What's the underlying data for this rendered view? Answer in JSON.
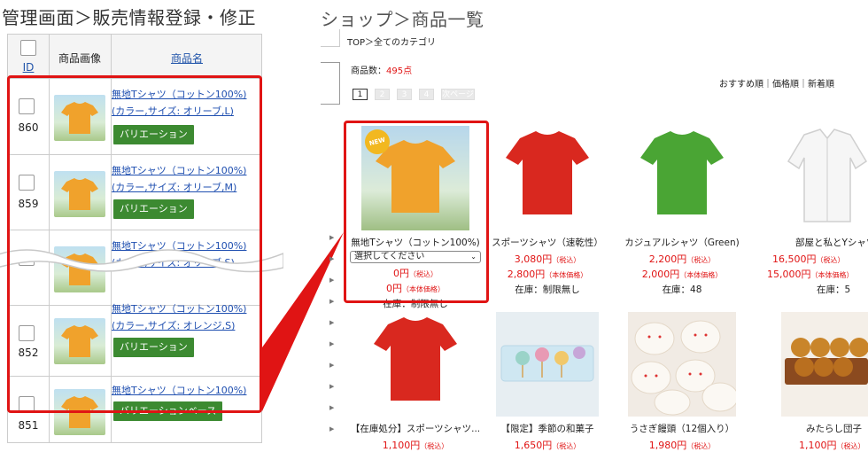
{
  "left": {
    "title": "管理画面＞販売情報登録・修正",
    "headers": {
      "id": "ID",
      "image": "商品画像",
      "name": "商品名"
    },
    "rows": [
      {
        "id": "860",
        "name1": "無地Tシャツ（コットン100%)",
        "name2": "(カラー,サイズ: オリーブ,L)",
        "button": "バリエーション"
      },
      {
        "id": "859",
        "name1": "無地Tシャツ（コットン100%)",
        "name2": "(カラー,サイズ: オリーブ,M)",
        "button": "バリエーション"
      },
      {
        "id": "",
        "name1": "無地Tシャツ（コットン100%)",
        "name2": "(カラー,サイズ: オリーブ,S)",
        "button": ""
      },
      {
        "id": "852",
        "name1": "無地Tシャツ（コットン100%)",
        "name2": "(カラー,サイズ: オレンジ,S)",
        "button": "バリエーション"
      },
      {
        "id": "851",
        "name1": "無地Tシャツ（コットン100%)",
        "name2": "",
        "button": "バリエーションベース"
      }
    ]
  },
  "right": {
    "title": "ショップ＞商品一覧",
    "breadcrumb": "TOP＞全てのカテゴリ",
    "count_label": "商品数：",
    "count_value": "495点",
    "pages": [
      "1",
      "2",
      "3",
      "4",
      "次ページ"
    ],
    "sorts": "おすすめ順｜価格順｜新着順",
    "badge_new": "NEW",
    "products": [
      {
        "title": "無地Tシャツ（コットン100%)",
        "select": "選択してください",
        "price1": "0円",
        "price1_note": "（税込）",
        "price2": "0円",
        "price2_note": "（本体価格）",
        "stock": "在庫：制限無し",
        "color": "#f0a22c"
      },
      {
        "title": "スポーツシャツ（速乾性）",
        "price1": "3,080円",
        "price1_note": "（税込）",
        "price2": "2,800円",
        "price2_note": "（本体価格）",
        "stock": "在庫：制限無し",
        "color": "#d9281f"
      },
      {
        "title": "カジュアルシャツ（Green)",
        "price1": "2,200円",
        "price1_note": "（税込）",
        "price2": "2,000円",
        "price2_note": "（本体価格）",
        "stock": "在庫：48",
        "color": "#4aa534"
      },
      {
        "title": "部屋と私とYシャツ",
        "price1": "16,500円",
        "price1_note": "（税込）",
        "price2": "15,000円",
        "price2_note": "（本体価格）",
        "stock": "在庫：5",
        "color": "#f4f4f4"
      },
      {
        "title": "【在庫処分】スポーツシャツ...",
        "price1": "1,100円",
        "price1_note": "（税込）",
        "color": "#d9281f"
      },
      {
        "title": "【限定】季節の和菓子",
        "price1": "1,650円",
        "price1_note": "（税込）",
        "color": "#cde5f0"
      },
      {
        "title": "うさぎ饅頭（12個入り）",
        "price1": "1,980円",
        "price1_note": "（税込）",
        "color": "#f3eee8"
      },
      {
        "title": "みたらし団子",
        "price1": "1,100円",
        "price1_note": "（税込）",
        "color": "#c9852a"
      }
    ]
  },
  "colors": {
    "highlight": "#e01414",
    "button_green": "#3c8a31",
    "link": "#1f4fb0",
    "price_red": "#e01414"
  }
}
